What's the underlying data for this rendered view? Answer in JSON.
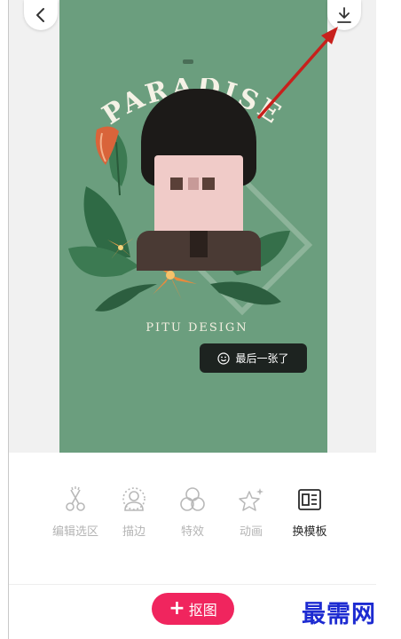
{
  "poster": {
    "title": "PARADISE",
    "subtitle": "PITU DESIGN",
    "toast": "最后一张了"
  },
  "toolbar": {
    "items": [
      {
        "label": "编辑选区",
        "icon": "scissors-icon"
      },
      {
        "label": "描边",
        "icon": "person-outline-icon"
      },
      {
        "label": "特效",
        "icon": "three-circles-icon"
      },
      {
        "label": "动画",
        "icon": "sparkle-star-icon"
      },
      {
        "label": "换模板",
        "icon": "template-icon"
      }
    ],
    "active_index": 4
  },
  "cutout_button": "抠图",
  "watermark": "最需网",
  "colors": {
    "poster_bg": "#6b9e7e",
    "accent": "#f0255e",
    "annotation_arrow": "#c8201c",
    "watermark": "#1d2bd1"
  }
}
